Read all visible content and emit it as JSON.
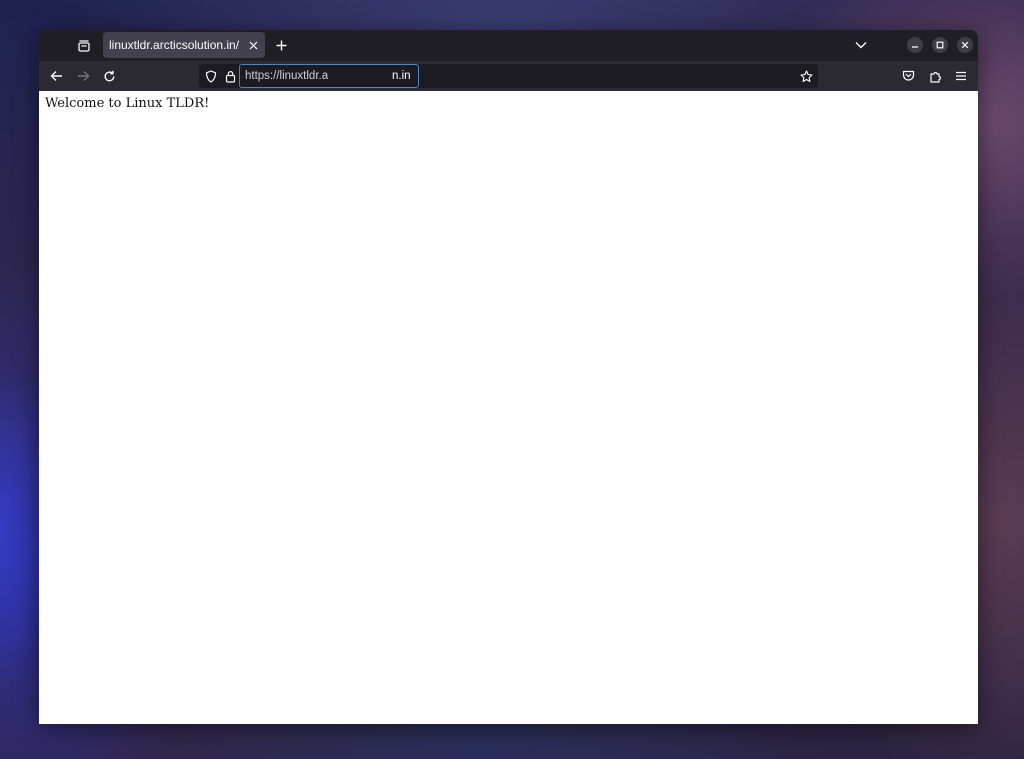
{
  "browser": {
    "tab": {
      "title": "linuxtldr.arcticsolution.in/"
    },
    "urlbar": {
      "url_prefix": "https://linuxtldr.a",
      "url_suffix": "n.in"
    },
    "icons": {
      "tab_list": "tab-list-icon",
      "close_tab": "close-icon",
      "new_tab": "plus-icon",
      "list_all_tabs": "chevron-down-icon",
      "minimize": "minimize-icon",
      "maximize": "maximize-icon",
      "close_window": "close-icon",
      "back": "arrow-left-icon",
      "forward": "arrow-right-icon",
      "reload": "reload-icon",
      "tracking_protection": "shield-icon",
      "site_security": "lock-icon",
      "bookmark": "star-icon",
      "pocket": "pocket-icon",
      "extensions": "puzzle-icon",
      "menu": "hamburger-menu-icon"
    },
    "colors": {
      "tabbar": "#1f1e25",
      "toolbar": "#2b2a33",
      "urlbar": "#1c1b22",
      "focus_ring": "#4a84c9",
      "page_background": "#ffffff"
    }
  },
  "page": {
    "heading": "Welcome to Linux TLDR!"
  }
}
